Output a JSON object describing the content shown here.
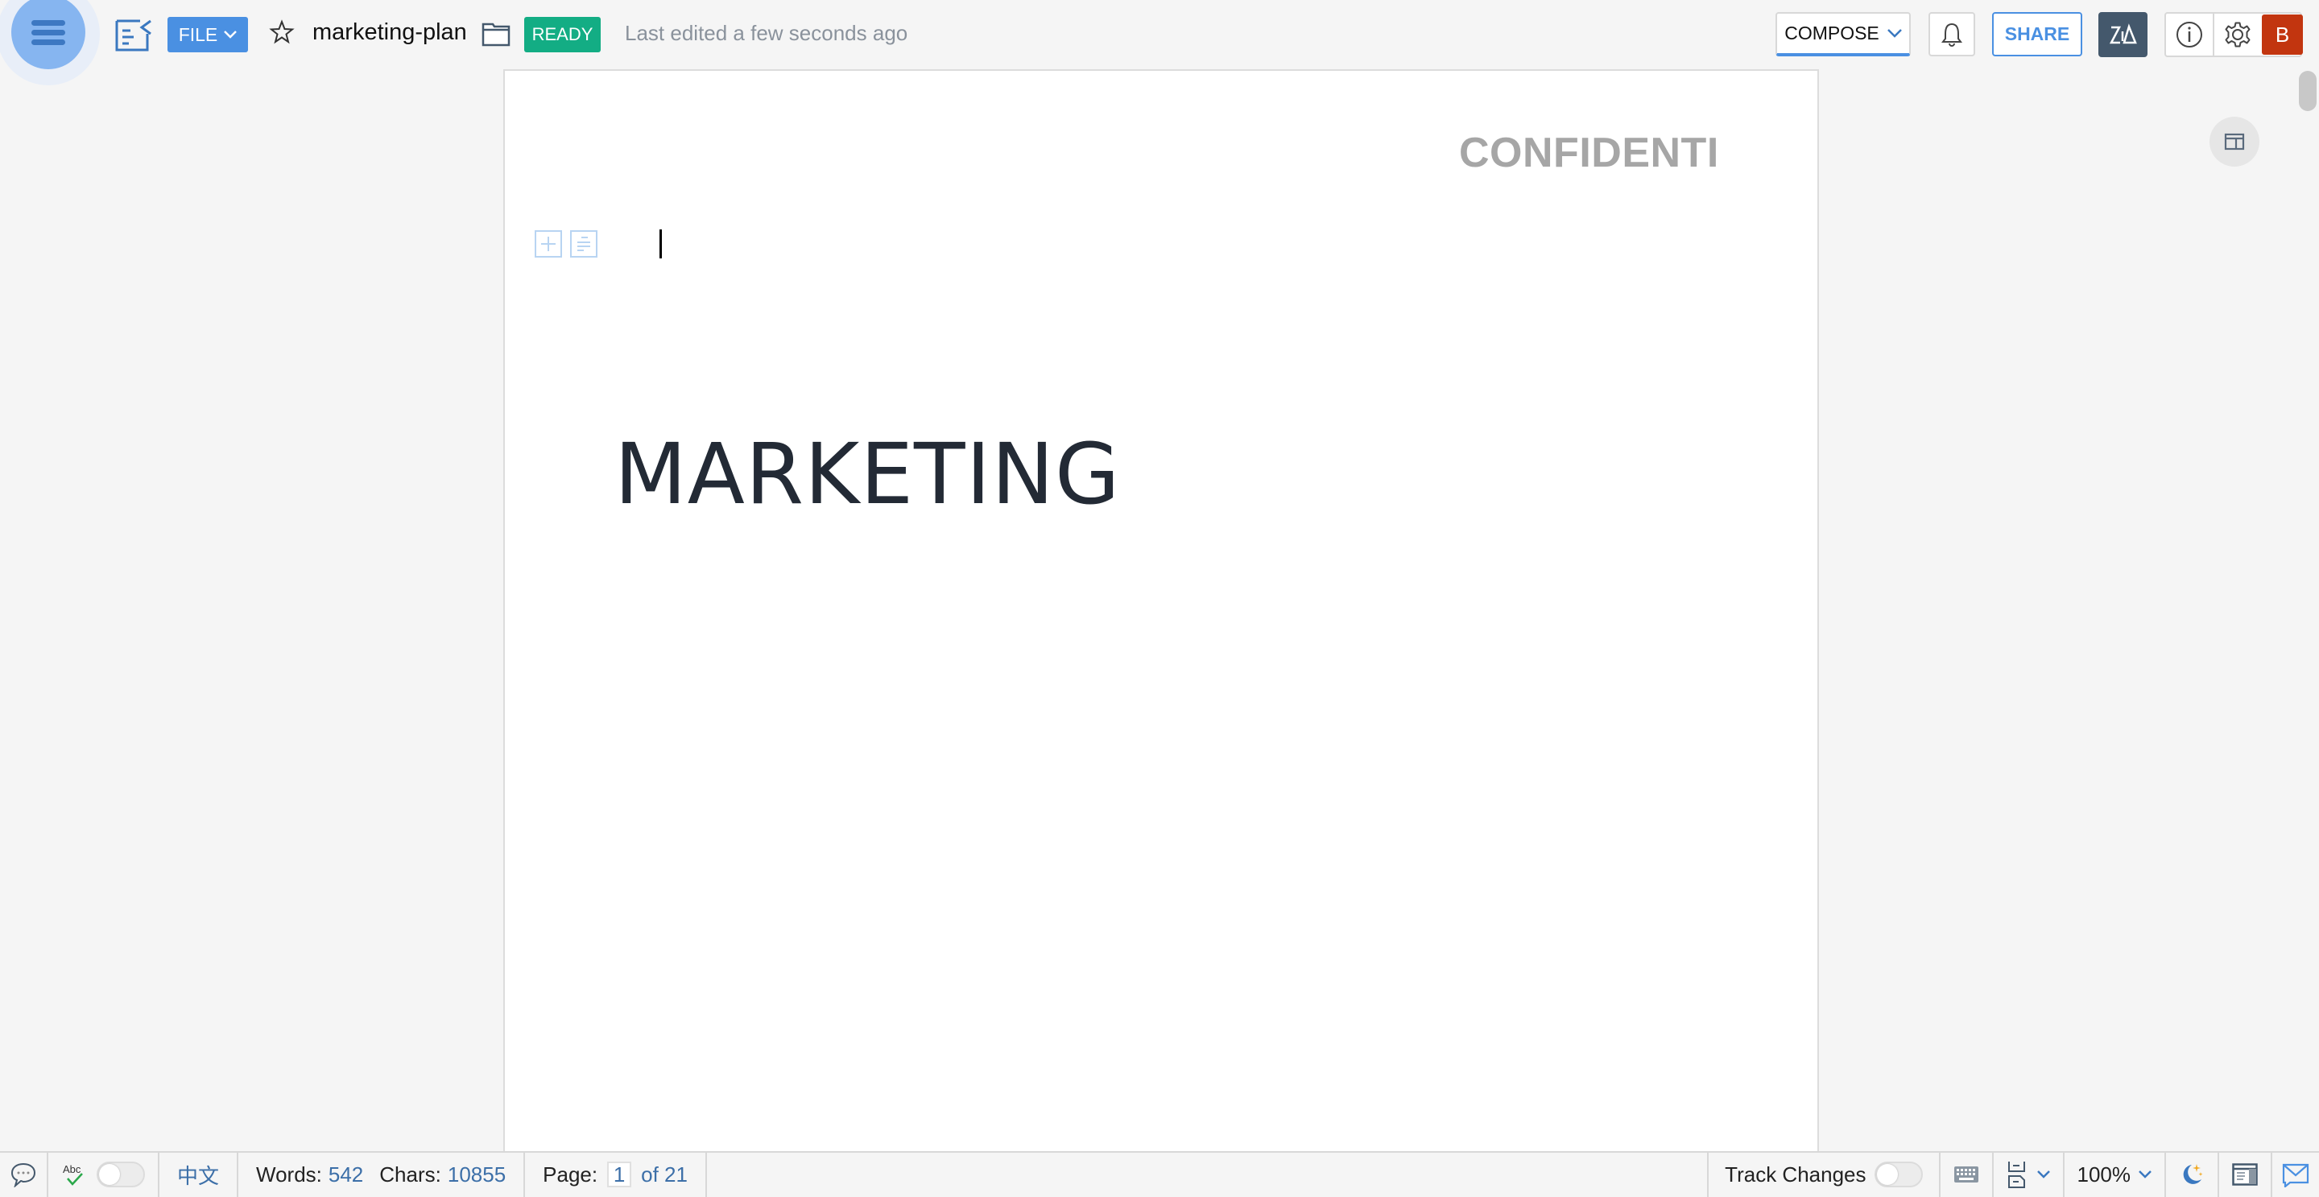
{
  "header": {
    "menu_icon": "hamburger-icon",
    "doc_icon": "writer-document-icon",
    "file_label": "FILE",
    "favorite_icon": "star-icon",
    "doc_name": "marketing-plan",
    "folder_icon": "folder-icon",
    "status_badge": "READY",
    "last_edited": "Last edited a few seconds ago",
    "compose_label": "COMPOSE",
    "notification_icon": "bell-icon",
    "share_label": "SHARE",
    "zia_label": "Zia",
    "info_icon": "info-icon",
    "settings_icon": "gear-icon",
    "avatar_initial": "B"
  },
  "document": {
    "header_text": "CONFIDENTI",
    "title": "MARKETING",
    "block_icons": [
      "add-block-icon",
      "paragraph-format-icon"
    ]
  },
  "side": {
    "panel_icon": "layout-panel-icon"
  },
  "status_bar": {
    "comment_icon": "comment-icon",
    "spellcheck_icon": "spellcheck-icon",
    "spellcheck_on": false,
    "language": "中文",
    "words_label": "Words:",
    "words_value": "542",
    "chars_label": "Chars:",
    "chars_value": "10855",
    "page_label": "Page:",
    "page_current": "1",
    "page_total": "of 21",
    "track_changes_label": "Track Changes",
    "track_changes_on": false,
    "keyboard_icon": "keyboard-icon",
    "page_view_icon": "page-view-icon",
    "zoom_value": "100%",
    "night_mode_icon": "night-mode-icon",
    "layout_icon": "reader-layout-icon",
    "mail_icon": "mail-icon"
  },
  "colors": {
    "accent": "#4a90e2",
    "ready": "#13ad84",
    "avatar": "#c2350f",
    "zia": "#44586c"
  }
}
